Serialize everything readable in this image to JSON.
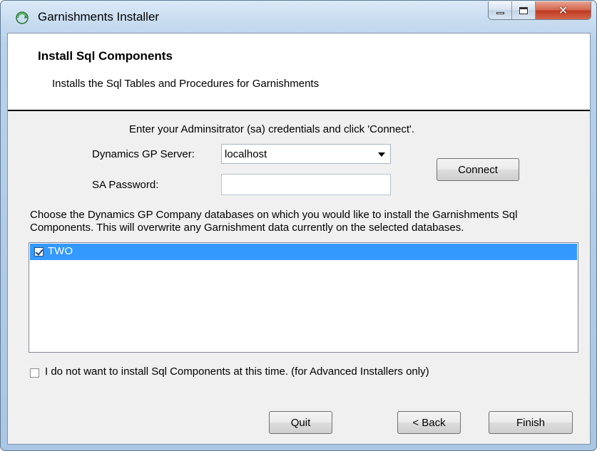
{
  "window": {
    "title": "Garnishments Installer"
  },
  "header": {
    "title": "Install Sql Components",
    "subtitle": "Installs the Sql Tables and Procedures for Garnishments"
  },
  "credentials": {
    "instruction": "Enter your Adminsitrator (sa) credentials and click 'Connect'.",
    "server_label": "Dynamics GP Server:",
    "server_value": "localhost",
    "password_label": "SA Password:",
    "password_value": "",
    "connect_label": "Connect"
  },
  "databases": {
    "instruction": "Choose the Dynamics GP Company databases on which you would like to install the Garnishments Sql Components. This will overwrite any Garnishment data currently on the selected databases.",
    "items": [
      {
        "label": "TWO",
        "checked": true,
        "selected": true
      }
    ]
  },
  "advanced": {
    "label": "I do not want to install Sql Components at this time. (for Advanced Installers only)",
    "checked": false
  },
  "footer": {
    "quit_label": "Quit",
    "back_label": "< Back",
    "finish_label": "Finish"
  },
  "colors": {
    "selection": "#3399ff",
    "header_background": "#ffffff",
    "dialog_background": "#f0f0f0"
  }
}
